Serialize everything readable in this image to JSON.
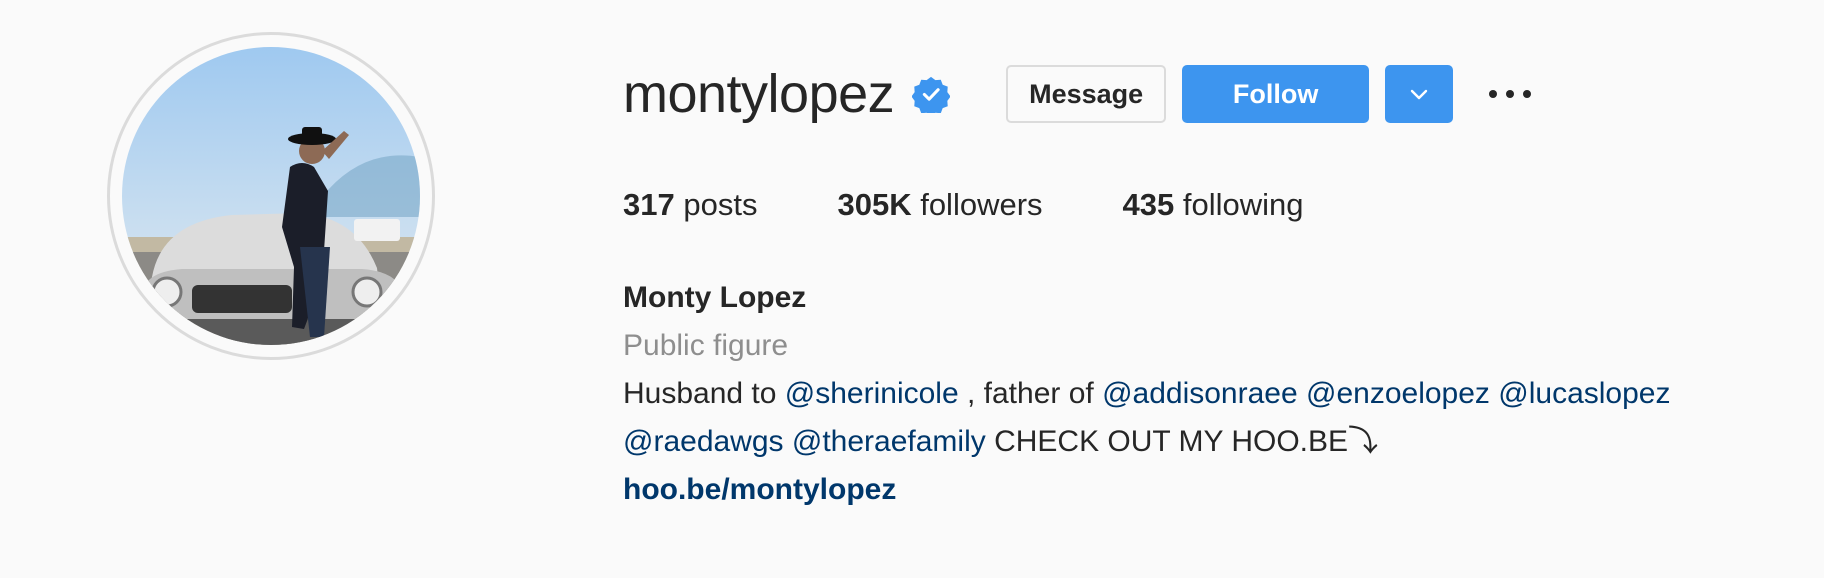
{
  "profile": {
    "username": "montylopez",
    "verified": true,
    "avatar_alt": "Man in hat leaning on a classic silver convertible",
    "buttons": {
      "message": "Message",
      "follow": "Follow"
    },
    "stats": [
      {
        "count": "317",
        "label": "posts"
      },
      {
        "count": "305K",
        "label": "followers"
      },
      {
        "count": "435",
        "label": "following"
      }
    ],
    "full_name": "Monty Lopez",
    "category": "Public figure",
    "bio": {
      "line1": {
        "t1": "Husband to ",
        "m1": "@sherinicole",
        "t2": " , father of ",
        "m2": "@addisonraee",
        "m3": "@enzoelopez",
        "m4": "@lucaslopez"
      },
      "line2": {
        "m1": "@raedawgs",
        "m2": "@theraefamily",
        "t1": " CHECK OUT MY HOO.BE⤵"
      }
    },
    "website": "hoo.be/montylopez"
  },
  "colors": {
    "background": "#fafafa",
    "primary_blue": "#3d95ef",
    "link": "#00376b",
    "muted": "#8e8e8e",
    "text": "#262626"
  },
  "icons": {
    "verified": "verified-badge-icon",
    "dropdown": "chevron-down-icon",
    "more": "more-options-icon"
  }
}
